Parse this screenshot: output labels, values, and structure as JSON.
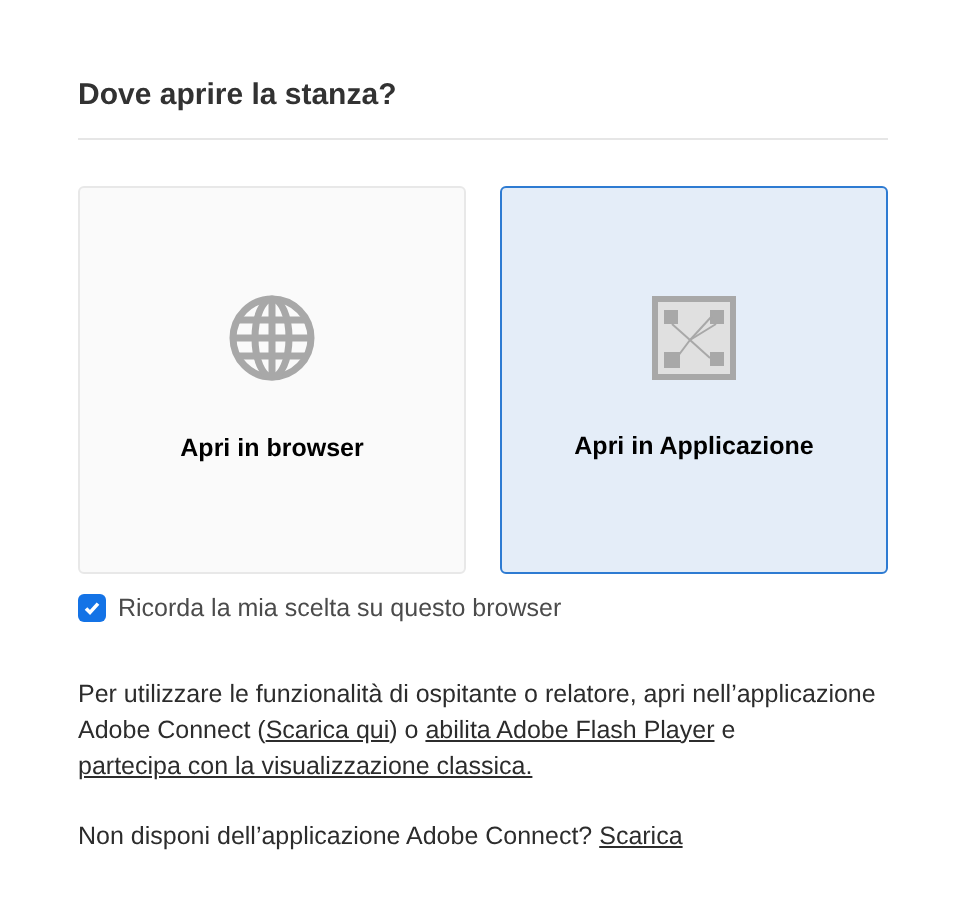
{
  "title": "Dove aprire la stanza?",
  "options": [
    {
      "kind": "globe",
      "label": "Apri in browser",
      "selected": false
    },
    {
      "kind": "app",
      "label": "Apri in Applicazione",
      "selected": true
    }
  ],
  "remember": {
    "label": "Ricorda la mia scelta su questo browser",
    "checked": true
  },
  "info": [
    {
      "kind": "text",
      "text": "Per utilizzare le funzionalità di ospitante o relatore, apri nell’applicazione Adobe Connect ("
    },
    {
      "kind": "link",
      "text": "Scarica qui"
    },
    {
      "kind": "text",
      "text": ") o "
    },
    {
      "kind": "link",
      "text": "abilita Adobe Flash Player"
    },
    {
      "kind": "text",
      "text": " e "
    },
    {
      "kind": "link",
      "text": "partecipa con la visualizzazione classica."
    }
  ],
  "download": [
    {
      "kind": "text",
      "text": "Non disponi dell’applicazione Adobe Connect? "
    },
    {
      "kind": "link",
      "text": "Scarica"
    }
  ]
}
